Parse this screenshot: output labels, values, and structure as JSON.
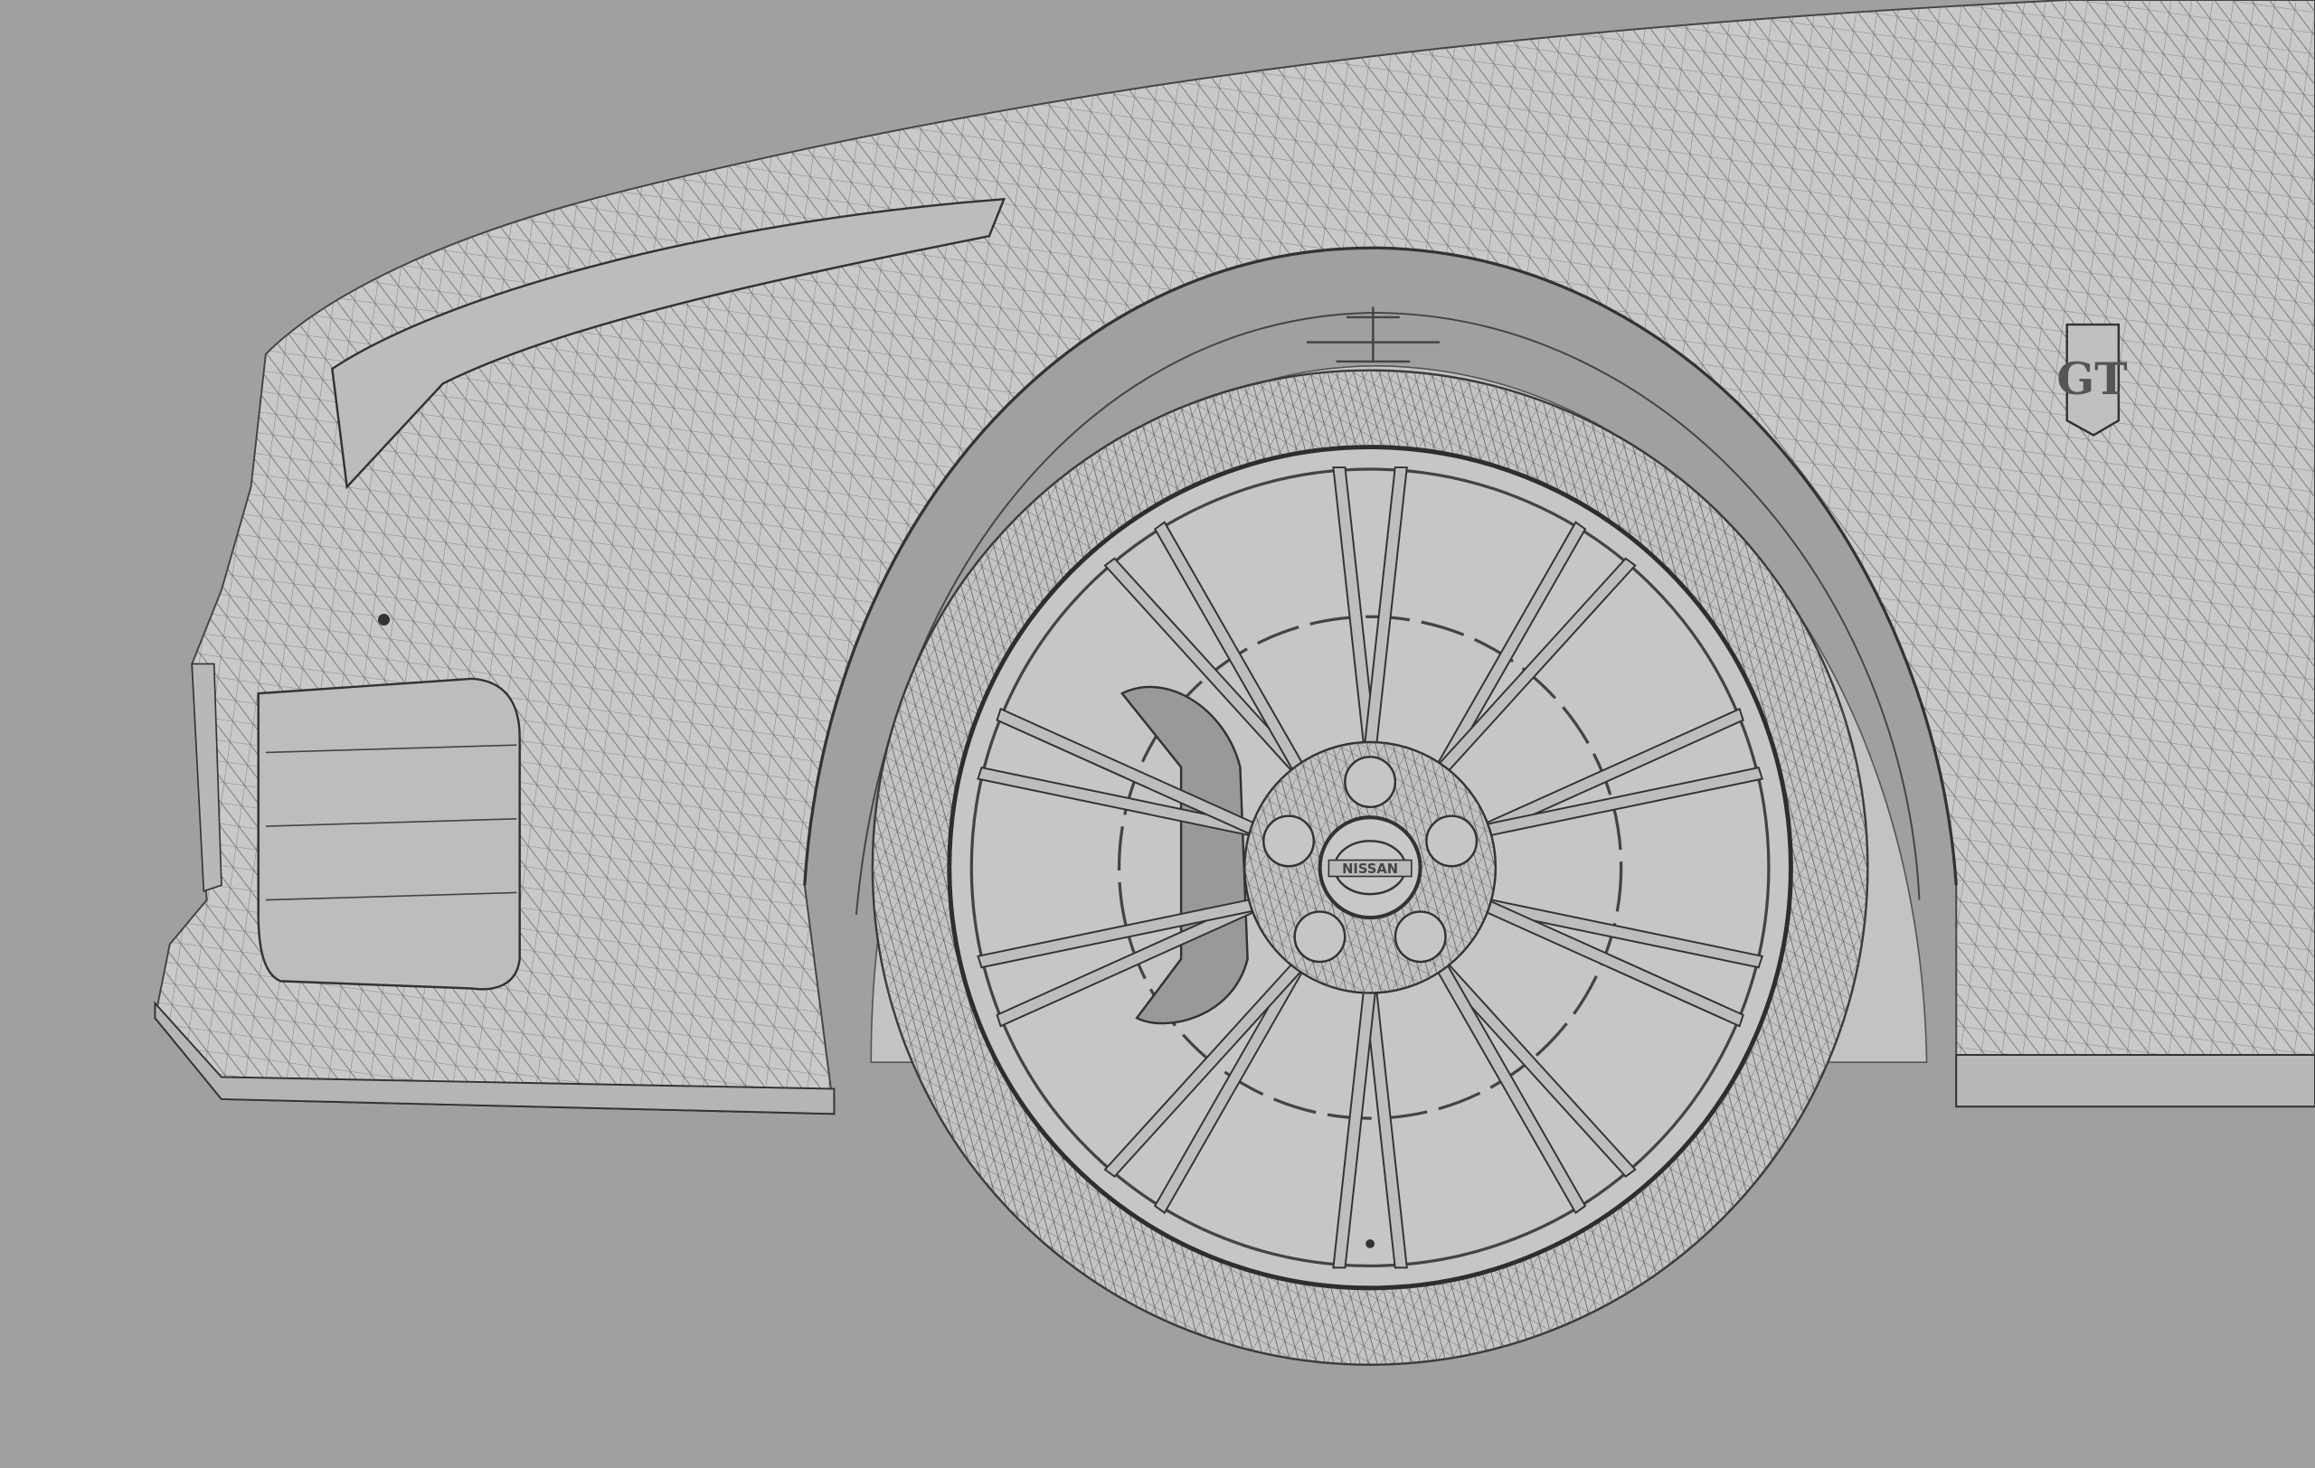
{
  "scene": {
    "subject": "wireframe-car-front-wheel",
    "colors": {
      "background": "#a0a0a0",
      "body": "#c9c9c9",
      "wire": "#4a4a4a",
      "tire": "#c4c4c4"
    }
  },
  "badges": {
    "fender_emblem": "GT",
    "center_cap": "NISSAN"
  },
  "wheel": {
    "spoke_count": 20,
    "lug_count": 5
  }
}
